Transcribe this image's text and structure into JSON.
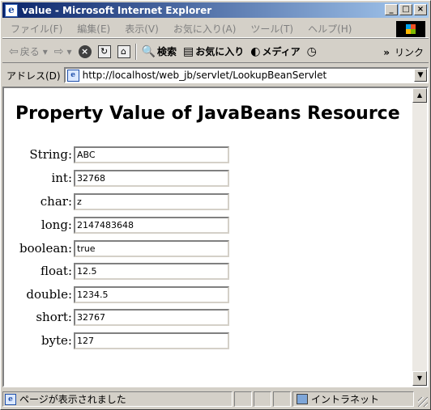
{
  "window": {
    "title": "value - Microsoft Internet Explorer",
    "app_icon_glyph": "e",
    "minimize_glyph": "_",
    "maximize_glyph": "□",
    "close_glyph": "×"
  },
  "menu": {
    "items": [
      "ファイル(F)",
      "編集(E)",
      "表示(V)",
      "お気に入り(A)",
      "ツール(T)",
      "ヘルプ(H)"
    ]
  },
  "toolbar": {
    "back_label": "戻る",
    "back_dropdown": "▾",
    "forward_glyph": "⇨",
    "forward_dropdown": "▾",
    "stop_glyph": "×",
    "refresh_glyph": "↻",
    "home_glyph": "⌂",
    "search_glyph": "🔍",
    "search_label": "検索",
    "favorites_glyph": "▤",
    "favorites_label": "お気に入り",
    "media_glyph": "◐",
    "media_label": "メディア",
    "history_glyph": "◷",
    "links_chevron": "»",
    "links_label": "リンク"
  },
  "address": {
    "label": "アドレス(D)",
    "url": "http://localhost/web_jb/servlet/LookupBeanServlet",
    "dropdown_glyph": "▼"
  },
  "page": {
    "title": "Property Value of JavaBeans Resource",
    "properties": [
      {
        "label": "String:",
        "value": "ABC"
      },
      {
        "label": "int:",
        "value": "32768"
      },
      {
        "label": "char:",
        "value": "z"
      },
      {
        "label": "long:",
        "value": "2147483648"
      },
      {
        "label": "boolean:",
        "value": "true"
      },
      {
        "label": "float:",
        "value": "12.5"
      },
      {
        "label": "double:",
        "value": "1234.5"
      },
      {
        "label": "short:",
        "value": "32767"
      },
      {
        "label": "byte:",
        "value": "127"
      }
    ]
  },
  "scrollbar": {
    "up_glyph": "▲",
    "down_glyph": "▼"
  },
  "status": {
    "message": "ページが表示されました",
    "zone": "イントラネット"
  }
}
